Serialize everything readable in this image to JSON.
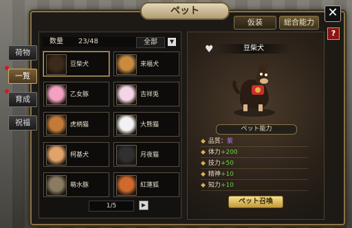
{
  "title": "ペット",
  "top_tabs": {
    "costume": "仮装",
    "total": "総合能力"
  },
  "side_tabs": {
    "items": "荷物",
    "list": "一覧",
    "train": "育成",
    "bless": "祝福"
  },
  "list": {
    "qty_label": "数量",
    "qty_value": "23/48",
    "filter": "全部",
    "page": "1/5"
  },
  "pets": [
    {
      "name": "豆柴犬",
      "color": "#3d2a1a"
    },
    {
      "name": "来福犬",
      "color": "#c98b3e"
    },
    {
      "name": "乙女豚",
      "color": "#f2a1c0"
    },
    {
      "name": "吉祥兎",
      "color": "#f4d5e5"
    },
    {
      "name": "虎柄猫",
      "color": "#c47b38"
    },
    {
      "name": "大熊猫",
      "color": "#f2f2f2"
    },
    {
      "name": "柯基犬",
      "color": "#e0a46a"
    },
    {
      "name": "月夜猫",
      "color": "#303030"
    },
    {
      "name": "萌水豚",
      "color": "#8a7c60"
    },
    {
      "name": "紅蓮狐",
      "color": "#d06a2c"
    }
  ],
  "selected": {
    "name": "豆柴犬"
  },
  "ability": {
    "title": "ペット能力",
    "stats": [
      {
        "label": "品質：",
        "value": "紫",
        "kind": "purple"
      },
      {
        "label": "体力",
        "value": "+200",
        "kind": "green"
      },
      {
        "label": "技力",
        "value": "+50",
        "kind": "green"
      },
      {
        "label": "精神",
        "value": "+10",
        "kind": "green"
      },
      {
        "label": "知力",
        "value": "+10",
        "kind": "green"
      }
    ]
  },
  "summon_label": "ペット召喚",
  "icons": {
    "close": "close-icon",
    "help": "help-icon",
    "heart": "heart-icon",
    "next": "next-icon",
    "dropdown": "dropdown-icon"
  }
}
